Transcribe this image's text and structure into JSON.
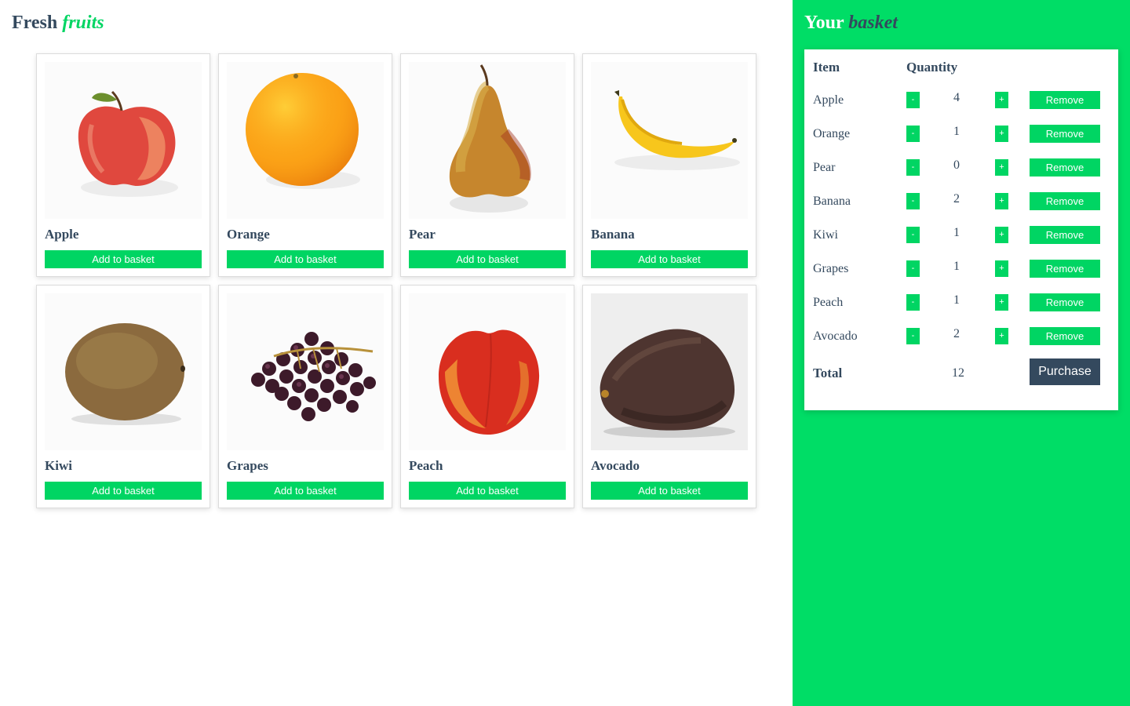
{
  "shop": {
    "title_main": "Fresh",
    "title_accent": "fruits",
    "products": [
      {
        "name": "Apple",
        "button": "Add to basket",
        "image": "apple-image"
      },
      {
        "name": "Orange",
        "button": "Add to basket",
        "image": "orange-image"
      },
      {
        "name": "Pear",
        "button": "Add to basket",
        "image": "pear-image"
      },
      {
        "name": "Banana",
        "button": "Add to basket",
        "image": "banana-image"
      },
      {
        "name": "Kiwi",
        "button": "Add to basket",
        "image": "kiwi-image"
      },
      {
        "name": "Grapes",
        "button": "Add to basket",
        "image": "grapes-image"
      },
      {
        "name": "Peach",
        "button": "Add to basket",
        "image": "peach-image"
      },
      {
        "name": "Avocado",
        "button": "Add to basket",
        "image": "avocado-image"
      }
    ]
  },
  "basket": {
    "title_main": "Your",
    "title_accent": "basket",
    "header_item": "Item",
    "header_quantity": "Quantity",
    "minus_label": "-",
    "plus_label": "+",
    "items": [
      {
        "name": "Apple",
        "quantity": "4",
        "remove": "Remove"
      },
      {
        "name": "Orange",
        "quantity": "1",
        "remove": "Remove"
      },
      {
        "name": "Pear",
        "quantity": "0",
        "remove": "Remove"
      },
      {
        "name": "Banana",
        "quantity": "2",
        "remove": "Remove"
      },
      {
        "name": "Kiwi",
        "quantity": "1",
        "remove": "Remove"
      },
      {
        "name": "Grapes",
        "quantity": "1",
        "remove": "Remove"
      },
      {
        "name": "Peach",
        "quantity": "1",
        "remove": "Remove"
      },
      {
        "name": "Avocado",
        "quantity": "2",
        "remove": "Remove"
      }
    ],
    "total_label": "Total",
    "total_value": "12",
    "purchase_label": "Purchase"
  },
  "colors": {
    "accent": "#00d563",
    "sidebar": "#00dd66",
    "dark": "#34495e",
    "white": "#ffffff"
  }
}
